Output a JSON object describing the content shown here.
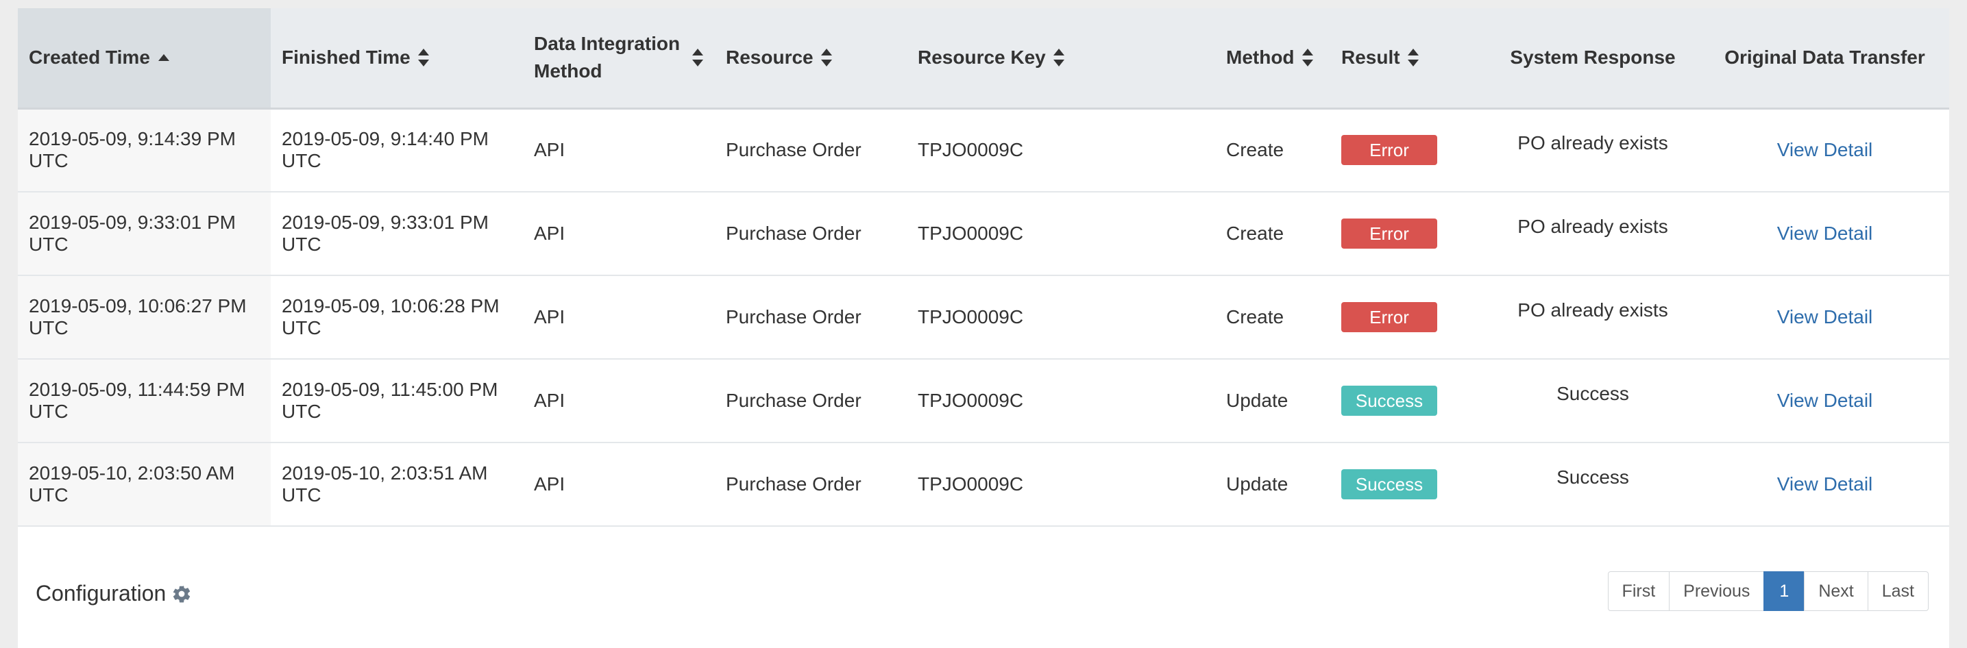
{
  "columns": {
    "created_time": "Created Time",
    "finished_time": "Finished Time",
    "method_line1": "Data Integration",
    "method_line2": "Method",
    "resource": "Resource",
    "resource_key": "Resource Key",
    "method": "Method",
    "result": "Result",
    "system_response": "System Response",
    "original_data_transfer": "Original Data Transfer"
  },
  "rows": [
    {
      "created_line1": "2019-05-09, 9:14:39 PM",
      "created_line2": "UTC",
      "finished_line1": "2019-05-09, 9:14:40 PM",
      "finished_line2": "UTC",
      "integration_method": "API",
      "resource": "Purchase Order",
      "resource_key": "TPJO0009C",
      "method": "Create",
      "result": "Error",
      "system_response": "PO already exists",
      "link": "View Detail"
    },
    {
      "created_line1": "2019-05-09, 9:33:01 PM",
      "created_line2": "UTC",
      "finished_line1": "2019-05-09, 9:33:01 PM",
      "finished_line2": "UTC",
      "integration_method": "API",
      "resource": "Purchase Order",
      "resource_key": "TPJO0009C",
      "method": "Create",
      "result": "Error",
      "system_response": "PO already exists",
      "link": "View Detail"
    },
    {
      "created_line1": "2019-05-09, 10:06:27 PM",
      "created_line2": "UTC",
      "finished_line1": "2019-05-09, 10:06:28 PM",
      "finished_line2": "UTC",
      "integration_method": "API",
      "resource": "Purchase Order",
      "resource_key": "TPJO0009C",
      "method": "Create",
      "result": "Error",
      "system_response": "PO already exists",
      "link": "View Detail"
    },
    {
      "created_line1": "2019-05-09, 11:44:59 PM",
      "created_line2": "UTC",
      "finished_line1": "2019-05-09, 11:45:00 PM",
      "finished_line2": "UTC",
      "integration_method": "API",
      "resource": "Purchase Order",
      "resource_key": "TPJO0009C",
      "method": "Update",
      "result": "Success",
      "system_response": "Success",
      "link": "View Detail"
    },
    {
      "created_line1": "2019-05-10, 2:03:50 AM",
      "created_line2": "UTC",
      "finished_line1": "2019-05-10, 2:03:51 AM",
      "finished_line2": "UTC",
      "integration_method": "API",
      "resource": "Purchase Order",
      "resource_key": "TPJO0009C",
      "method": "Update",
      "result": "Success",
      "system_response": "Success",
      "link": "View Detail"
    }
  ],
  "footer": {
    "configuration_label": "Configuration",
    "configuration_icon": "gear-icon"
  },
  "pagination": {
    "first": "First",
    "previous": "Previous",
    "current": "1",
    "next": "Next",
    "last": "Last"
  },
  "colors": {
    "error": "#d9534f",
    "success": "#4ebfb9",
    "link": "#2e6dac",
    "active_page": "#3a78b8",
    "header_bg": "#e9ecef"
  }
}
